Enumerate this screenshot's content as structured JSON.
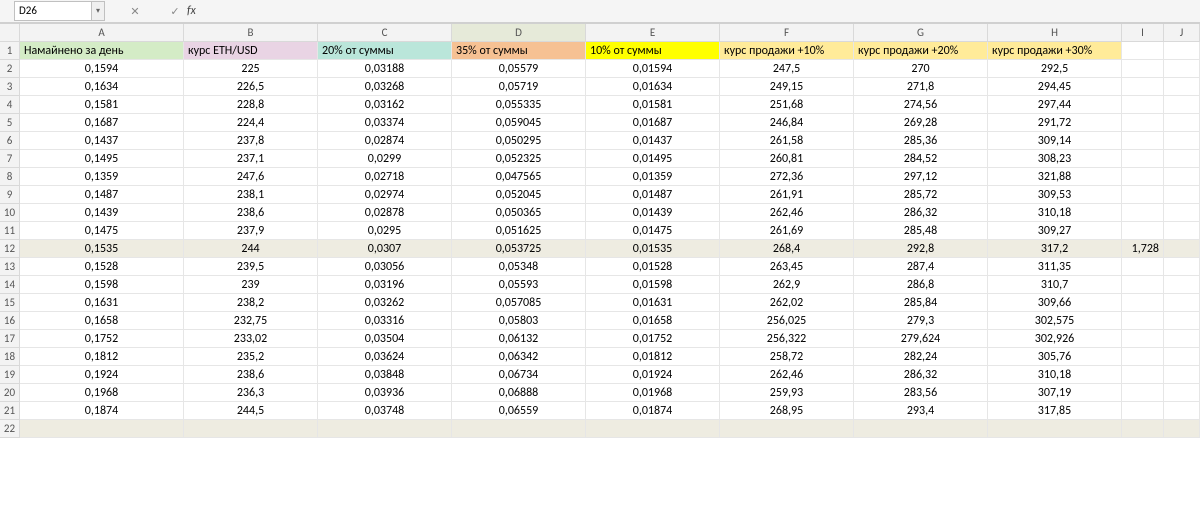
{
  "namebox": "D26",
  "fx_icons": {
    "cancel": "✕",
    "confirm": "✓",
    "fx": "fx"
  },
  "formula": "",
  "columns": [
    "A",
    "B",
    "C",
    "D",
    "E",
    "F",
    "G",
    "H",
    "I",
    "J"
  ],
  "selected_col": "D",
  "row_labels": [
    "1",
    "2",
    "3",
    "4",
    "5",
    "6",
    "7",
    "8",
    "9",
    "10",
    "11",
    "12",
    "13",
    "14",
    "15",
    "16",
    "17",
    "18",
    "19",
    "20",
    "21",
    "22"
  ],
  "highlight_rows": [
    12,
    22
  ],
  "headers": {
    "A": "Намайнено за день",
    "B": "курс ETH/USD",
    "C": "20% от суммы",
    "D": "35% от суммы",
    "E": "10% от суммы",
    "F": "курс продажи +10%",
    "G": "курс продажи +20%",
    "H": "курс продажи +30%"
  },
  "rows": [
    {
      "A": "0,1594",
      "B": "225",
      "C": "0,03188",
      "D": "0,05579",
      "E": "0,01594",
      "F": "247,5",
      "G": "270",
      "H": "292,5",
      "I": ""
    },
    {
      "A": "0,1634",
      "B": "226,5",
      "C": "0,03268",
      "D": "0,05719",
      "E": "0,01634",
      "F": "249,15",
      "G": "271,8",
      "H": "294,45",
      "I": ""
    },
    {
      "A": "0,1581",
      "B": "228,8",
      "C": "0,03162",
      "D": "0,055335",
      "E": "0,01581",
      "F": "251,68",
      "G": "274,56",
      "H": "297,44",
      "I": ""
    },
    {
      "A": "0,1687",
      "B": "224,4",
      "C": "0,03374",
      "D": "0,059045",
      "E": "0,01687",
      "F": "246,84",
      "G": "269,28",
      "H": "291,72",
      "I": ""
    },
    {
      "A": "0,1437",
      "B": "237,8",
      "C": "0,02874",
      "D": "0,050295",
      "E": "0,01437",
      "F": "261,58",
      "G": "285,36",
      "H": "309,14",
      "I": ""
    },
    {
      "A": "0,1495",
      "B": "237,1",
      "C": "0,0299",
      "D": "0,052325",
      "E": "0,01495",
      "F": "260,81",
      "G": "284,52",
      "H": "308,23",
      "I": ""
    },
    {
      "A": "0,1359",
      "B": "247,6",
      "C": "0,02718",
      "D": "0,047565",
      "E": "0,01359",
      "F": "272,36",
      "G": "297,12",
      "H": "321,88",
      "I": ""
    },
    {
      "A": "0,1487",
      "B": "238,1",
      "C": "0,02974",
      "D": "0,052045",
      "E": "0,01487",
      "F": "261,91",
      "G": "285,72",
      "H": "309,53",
      "I": ""
    },
    {
      "A": "0,1439",
      "B": "238,6",
      "C": "0,02878",
      "D": "0,050365",
      "E": "0,01439",
      "F": "262,46",
      "G": "286,32",
      "H": "310,18",
      "I": ""
    },
    {
      "A": "0,1475",
      "B": "237,9",
      "C": "0,0295",
      "D": "0,051625",
      "E": "0,01475",
      "F": "261,69",
      "G": "285,48",
      "H": "309,27",
      "I": ""
    },
    {
      "A": "0,1535",
      "B": "244",
      "C": "0,0307",
      "D": "0,053725",
      "E": "0,01535",
      "F": "268,4",
      "G": "292,8",
      "H": "317,2",
      "I": "1,728"
    },
    {
      "A": "0,1528",
      "B": "239,5",
      "C": "0,03056",
      "D": "0,05348",
      "E": "0,01528",
      "F": "263,45",
      "G": "287,4",
      "H": "311,35",
      "I": ""
    },
    {
      "A": "0,1598",
      "B": "239",
      "C": "0,03196",
      "D": "0,05593",
      "E": "0,01598",
      "F": "262,9",
      "G": "286,8",
      "H": "310,7",
      "I": ""
    },
    {
      "A": "0,1631",
      "B": "238,2",
      "C": "0,03262",
      "D": "0,057085",
      "E": "0,01631",
      "F": "262,02",
      "G": "285,84",
      "H": "309,66",
      "I": ""
    },
    {
      "A": "0,1658",
      "B": "232,75",
      "C": "0,03316",
      "D": "0,05803",
      "E": "0,01658",
      "F": "256,025",
      "G": "279,3",
      "H": "302,575",
      "I": ""
    },
    {
      "A": "0,1752",
      "B": "233,02",
      "C": "0,03504",
      "D": "0,06132",
      "E": "0,01752",
      "F": "256,322",
      "G": "279,624",
      "H": "302,926",
      "I": ""
    },
    {
      "A": "0,1812",
      "B": "235,2",
      "C": "0,03624",
      "D": "0,06342",
      "E": "0,01812",
      "F": "258,72",
      "G": "282,24",
      "H": "305,76",
      "I": ""
    },
    {
      "A": "0,1924",
      "B": "238,6",
      "C": "0,03848",
      "D": "0,06734",
      "E": "0,01924",
      "F": "262,46",
      "G": "286,32",
      "H": "310,18",
      "I": ""
    },
    {
      "A": "0,1968",
      "B": "236,3",
      "C": "0,03936",
      "D": "0,06888",
      "E": "0,01968",
      "F": "259,93",
      "G": "283,56",
      "H": "307,19",
      "I": ""
    },
    {
      "A": "0,1874",
      "B": "244,5",
      "C": "0,03748",
      "D": "0,06559",
      "E": "0,01874",
      "F": "268,95",
      "G": "293,4",
      "H": "317,85",
      "I": ""
    }
  ]
}
